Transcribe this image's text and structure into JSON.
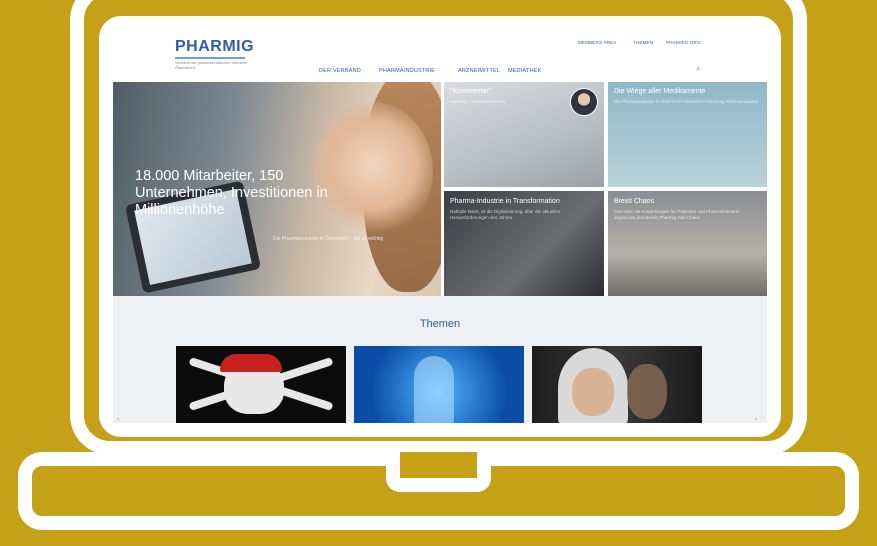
{
  "site": {
    "logo": "PHARMIG",
    "logo_sub": "Verband der pharmazeutischen Industrie Österreichs",
    "top_nav": [
      "MEMBERS AREA",
      "THEMEN",
      "PHARMIG.ORG"
    ],
    "main_nav": [
      "DER VERBAND",
      "PHARMAINDUSTRIE",
      "ARZNEIMITTEL",
      "MEDIATHEK"
    ]
  },
  "hero": {
    "title": "18.000 Mitarbeiter, 150 Unternehmen, Investitionen in Millionenhöhe",
    "subtitle": "Die Pharmaindustrie in Österreich – die ist wichtig"
  },
  "tiles": [
    {
      "title": "\"Kommentar\"",
      "subtitle": "von Mag. Alexander Herzog"
    },
    {
      "title": "Die Wiege aller Medikamente",
      "subtitle": "Die Pharmaindustrie in Österreich: Klinische Forschung Pharmaindustrie"
    },
    {
      "title": "Pharma-Industrie in Transformation",
      "subtitle": "Nathalie Mack, ist die Digitalisierung, über die aktuellen Herausforderungen des Jahres"
    },
    {
      "title": "Brexit Chaos",
      "subtitle": "Also über die Auswirkungen für Patienten und Pharmaindustrie, angesichts des Brexit, Pharmig zum Chaos"
    }
  ],
  "themen": {
    "heading": "Themen"
  },
  "icons": {
    "search": "search-icon",
    "prev": "chevron-left-icon",
    "next": "chevron-right-icon"
  },
  "colors": {
    "background": "#c4a116",
    "brand": "#2d5fa8"
  }
}
